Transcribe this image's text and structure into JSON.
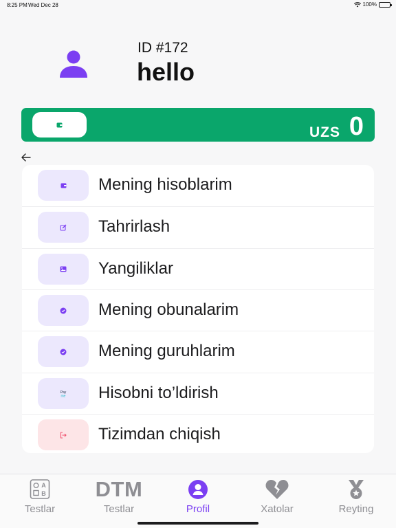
{
  "status_bar": {
    "time": "8:25 PM",
    "date": "Wed Dec 28",
    "battery": "100%"
  },
  "profile": {
    "id_label": "ID #172",
    "name": "hello"
  },
  "balance": {
    "currency": "UZS",
    "amount": "0",
    "bar_color": "#0aa66b"
  },
  "menu": {
    "items": [
      {
        "label": "Mening hisoblarim",
        "icon": "wallet-icon"
      },
      {
        "label": "Tahrirlash",
        "icon": "edit-icon"
      },
      {
        "label": "Yangiliklar",
        "icon": "image-icon"
      },
      {
        "label": "Mening obunalarim",
        "icon": "check-badge-icon"
      },
      {
        "label": "Mening guruhlarim",
        "icon": "check-badge-icon"
      },
      {
        "label": "Hisobni to’ldirish",
        "icon": "payme-icon"
      },
      {
        "label": "Tizimdan chiqish",
        "icon": "logout-icon"
      }
    ]
  },
  "tabs": [
    {
      "label": "Testlar",
      "icon": "quiz-grid-icon"
    },
    {
      "label": "Testlar",
      "icon_text": "DTM"
    },
    {
      "label": "Profil",
      "icon": "user-circle-icon",
      "active": true
    },
    {
      "label": "Xatolar",
      "icon": "broken-heart-icon"
    },
    {
      "label": "Reyting",
      "icon": "medal-icon"
    }
  ],
  "colors": {
    "accent": "#7b3ff2",
    "icon_bg": "#ece8fd",
    "danger_bg": "#fde5e7",
    "danger": "#f0506e"
  }
}
